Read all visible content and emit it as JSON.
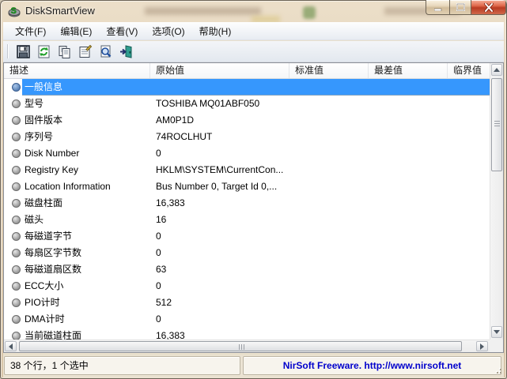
{
  "window": {
    "title": "DiskSmartView",
    "caption_buttons": {
      "minimize": "minimize",
      "maximize": "maximize",
      "close": "close"
    }
  },
  "menu_bar": {
    "items": [
      {
        "label": "文件(F)"
      },
      {
        "label": "编辑(E)"
      },
      {
        "label": "查看(V)"
      },
      {
        "label": "选项(O)"
      },
      {
        "label": "帮助(H)"
      }
    ]
  },
  "toolbar": {
    "buttons": [
      {
        "name": "save",
        "icon": "save-icon"
      },
      {
        "name": "refresh",
        "icon": "refresh-icon"
      },
      {
        "name": "copy",
        "icon": "copy-icon"
      },
      {
        "name": "properties",
        "icon": "properties-icon"
      },
      {
        "name": "find",
        "icon": "find-icon"
      },
      {
        "name": "exit",
        "icon": "exit-icon"
      }
    ]
  },
  "table": {
    "columns": [
      {
        "label": "描述"
      },
      {
        "label": "原始值"
      },
      {
        "label": "标准值"
      },
      {
        "label": "最差值"
      },
      {
        "label": "临界值"
      }
    ],
    "rows": [
      {
        "description": "一般信息",
        "raw_value": "",
        "selected": true
      },
      {
        "description": "型号",
        "raw_value": "TOSHIBA MQ01ABF050"
      },
      {
        "description": "固件版本",
        "raw_value": "AM0P1D"
      },
      {
        "description": "序列号",
        "raw_value": "74ROCLHUT"
      },
      {
        "description": "Disk Number",
        "raw_value": "0"
      },
      {
        "description": "Registry Key",
        "raw_value": "HKLM\\SYSTEM\\CurrentCon..."
      },
      {
        "description": "Location Information",
        "raw_value": "Bus Number 0, Target Id 0,..."
      },
      {
        "description": "磁盘柱面",
        "raw_value": "16,383"
      },
      {
        "description": "磁头",
        "raw_value": "16"
      },
      {
        "description": "每磁道字节",
        "raw_value": "0"
      },
      {
        "description": "每扇区字节数",
        "raw_value": "0"
      },
      {
        "description": "每磁道扇区数",
        "raw_value": "63"
      },
      {
        "description": "ECC大小",
        "raw_value": "0"
      },
      {
        "description": "PIO计时",
        "raw_value": "512"
      },
      {
        "description": "DMA计时",
        "raw_value": "0"
      },
      {
        "description": "当前磁道柱面",
        "raw_value": "16,383"
      }
    ]
  },
  "status_bar": {
    "left_text": "38 个行，1 个选中",
    "right_text": "NirSoft Freeware.  http://www.nirsoft.net"
  },
  "colors": {
    "selection": "#3697fd",
    "link": "#0000cc",
    "frame": "#dcc9ae",
    "close_button": "#b93b22"
  }
}
